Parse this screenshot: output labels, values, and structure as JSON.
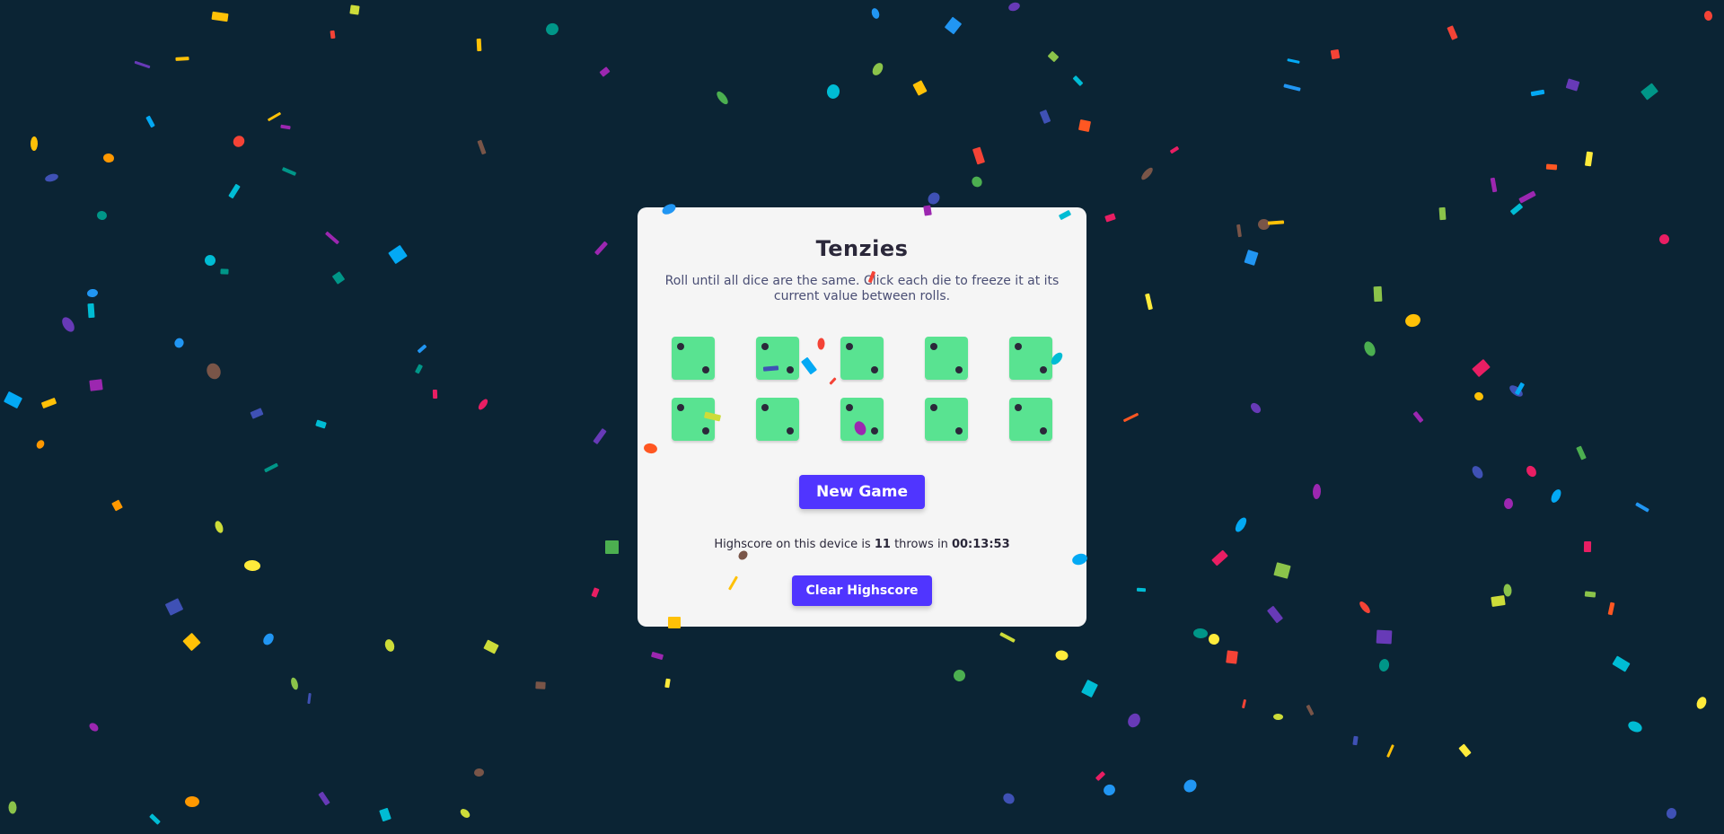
{
  "card": {
    "title": "Tenzies",
    "instructions": "Roll until all dice are the same. Click each die to freeze it at its current value between rolls."
  },
  "dice": [
    {
      "value": 2
    },
    {
      "value": 2
    },
    {
      "value": 2
    },
    {
      "value": 2
    },
    {
      "value": 2
    },
    {
      "value": 2
    },
    {
      "value": 2
    },
    {
      "value": 2
    },
    {
      "value": 2
    },
    {
      "value": 2
    }
  ],
  "buttons": {
    "new_game": "New Game",
    "clear_highscore": "Clear Highscore"
  },
  "highscore": {
    "prefix": "Highscore on this device is ",
    "throws": "11",
    "middle": " throws in ",
    "time": "00:13:53"
  },
  "colors": {
    "background": "#0b2434",
    "card": "#f5f5f5",
    "die": "#59e391",
    "accent": "#5035ff"
  }
}
